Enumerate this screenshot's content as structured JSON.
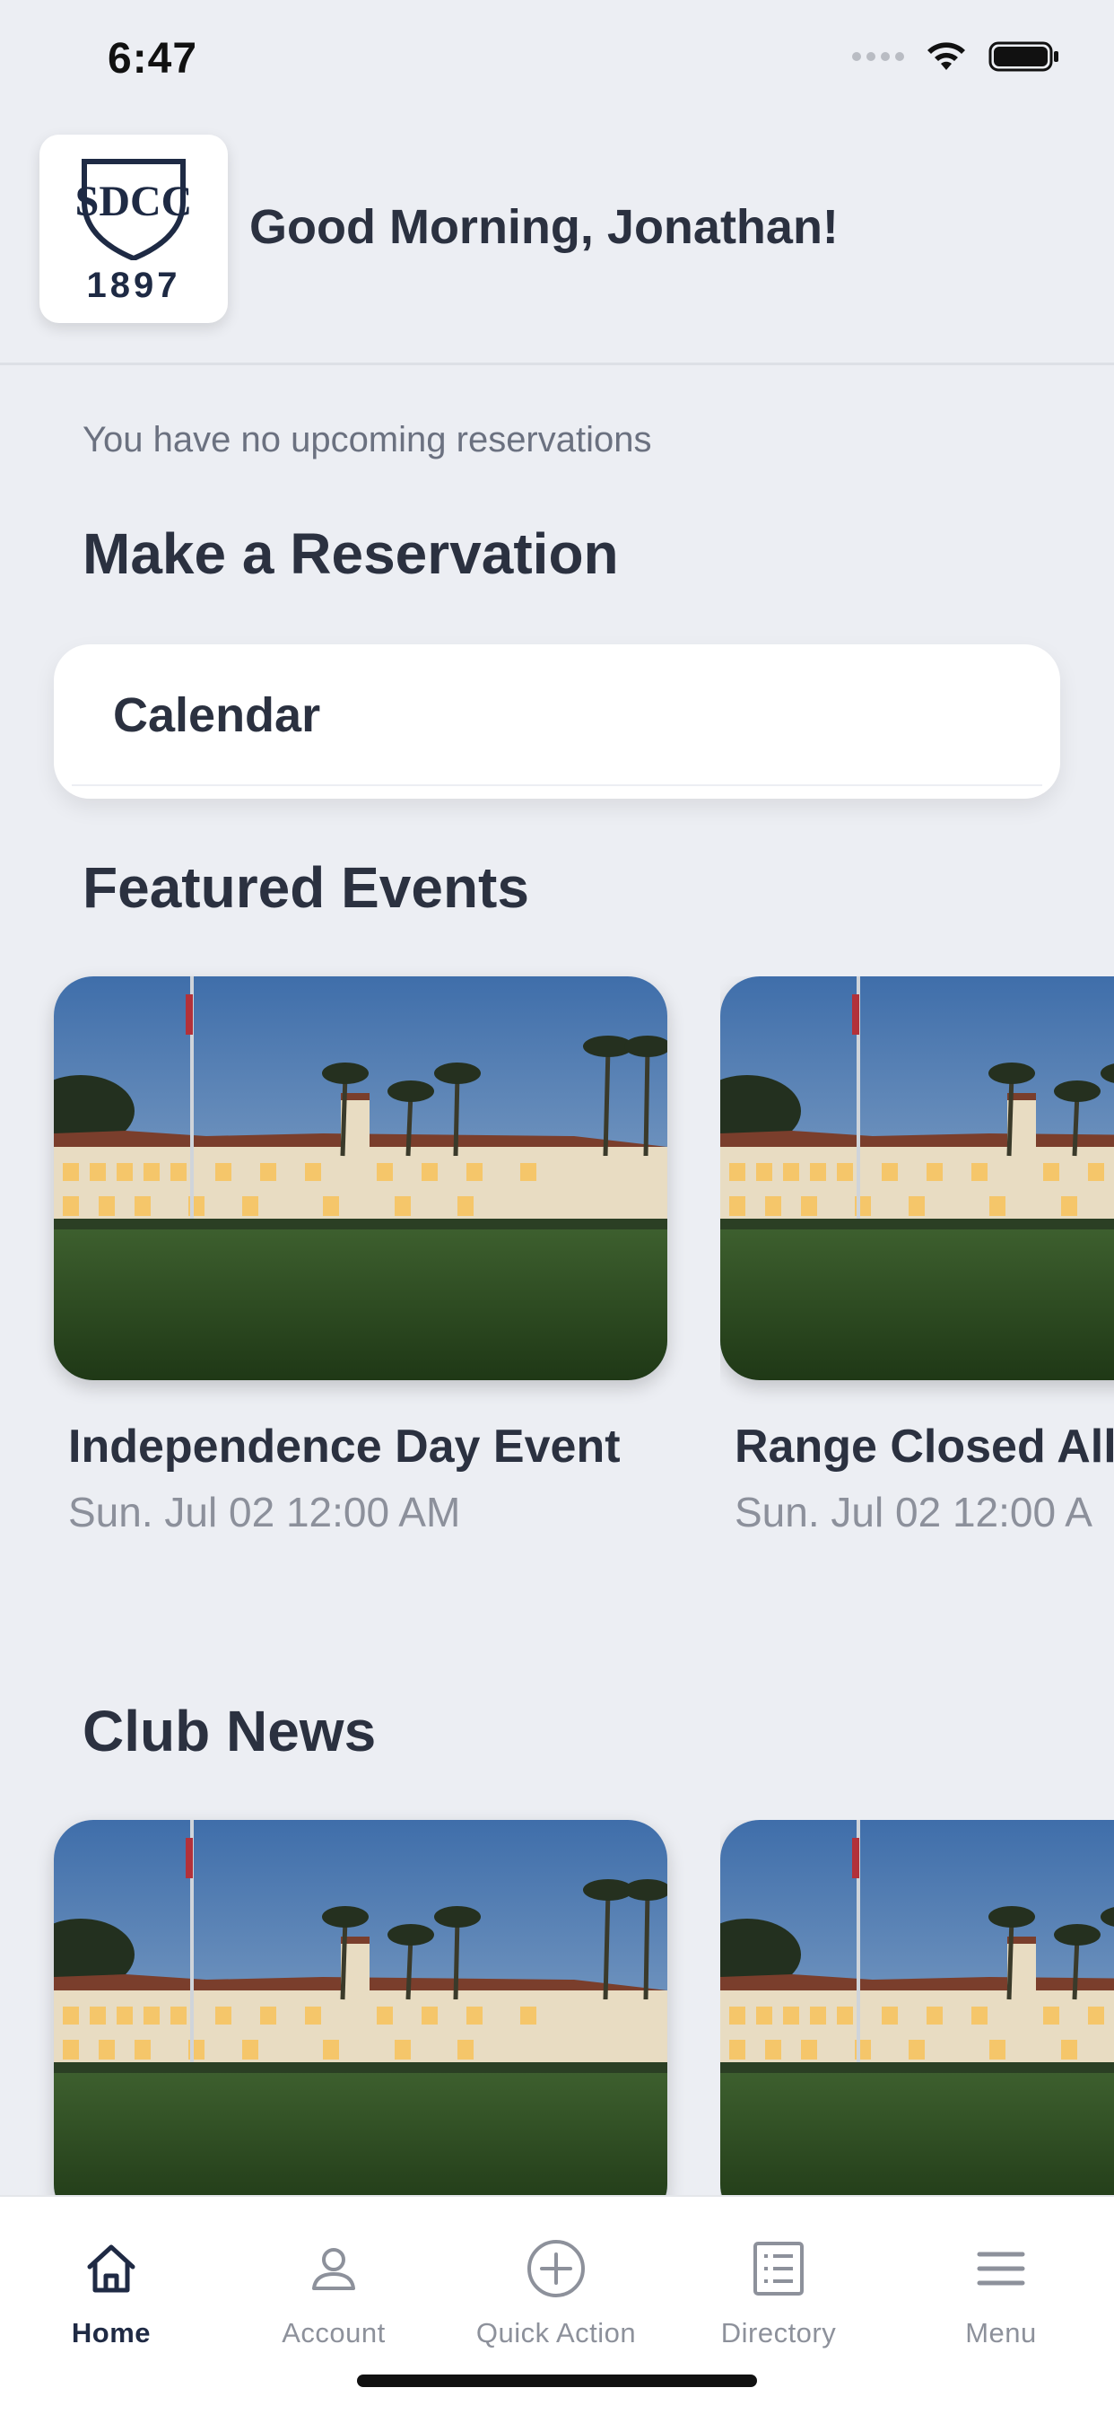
{
  "status_bar": {
    "time": "6:47"
  },
  "header": {
    "logo_monogram": "SDCC",
    "logo_year": "1897",
    "greeting": "Good Morning, Jonathan!"
  },
  "reservations": {
    "empty_text": "You have no upcoming reservations",
    "section_title": "Make a Reservation",
    "calendar_label": "Calendar"
  },
  "featured_events": {
    "section_title": "Featured Events",
    "items": [
      {
        "title": "Independence Day Event",
        "date": "Sun. Jul 02 12:00 AM"
      },
      {
        "title": "Range Closed All",
        "date": "Sun. Jul 02 12:00 A"
      }
    ]
  },
  "club_news": {
    "section_title": "Club News"
  },
  "tabbar": {
    "tabs": [
      {
        "label": "Home",
        "icon": "home-icon",
        "active": true
      },
      {
        "label": "Account",
        "icon": "person-icon",
        "active": false
      },
      {
        "label": "Quick Action",
        "icon": "plus-circle-icon",
        "active": false
      },
      {
        "label": "Directory",
        "icon": "list-icon",
        "active": false
      },
      {
        "label": "Menu",
        "icon": "hamburger-icon",
        "active": false
      }
    ]
  },
  "colors": {
    "background": "#eceef3",
    "text_primary": "#2b3140",
    "text_secondary": "#8c909b",
    "brand_navy": "#1e2a44"
  }
}
